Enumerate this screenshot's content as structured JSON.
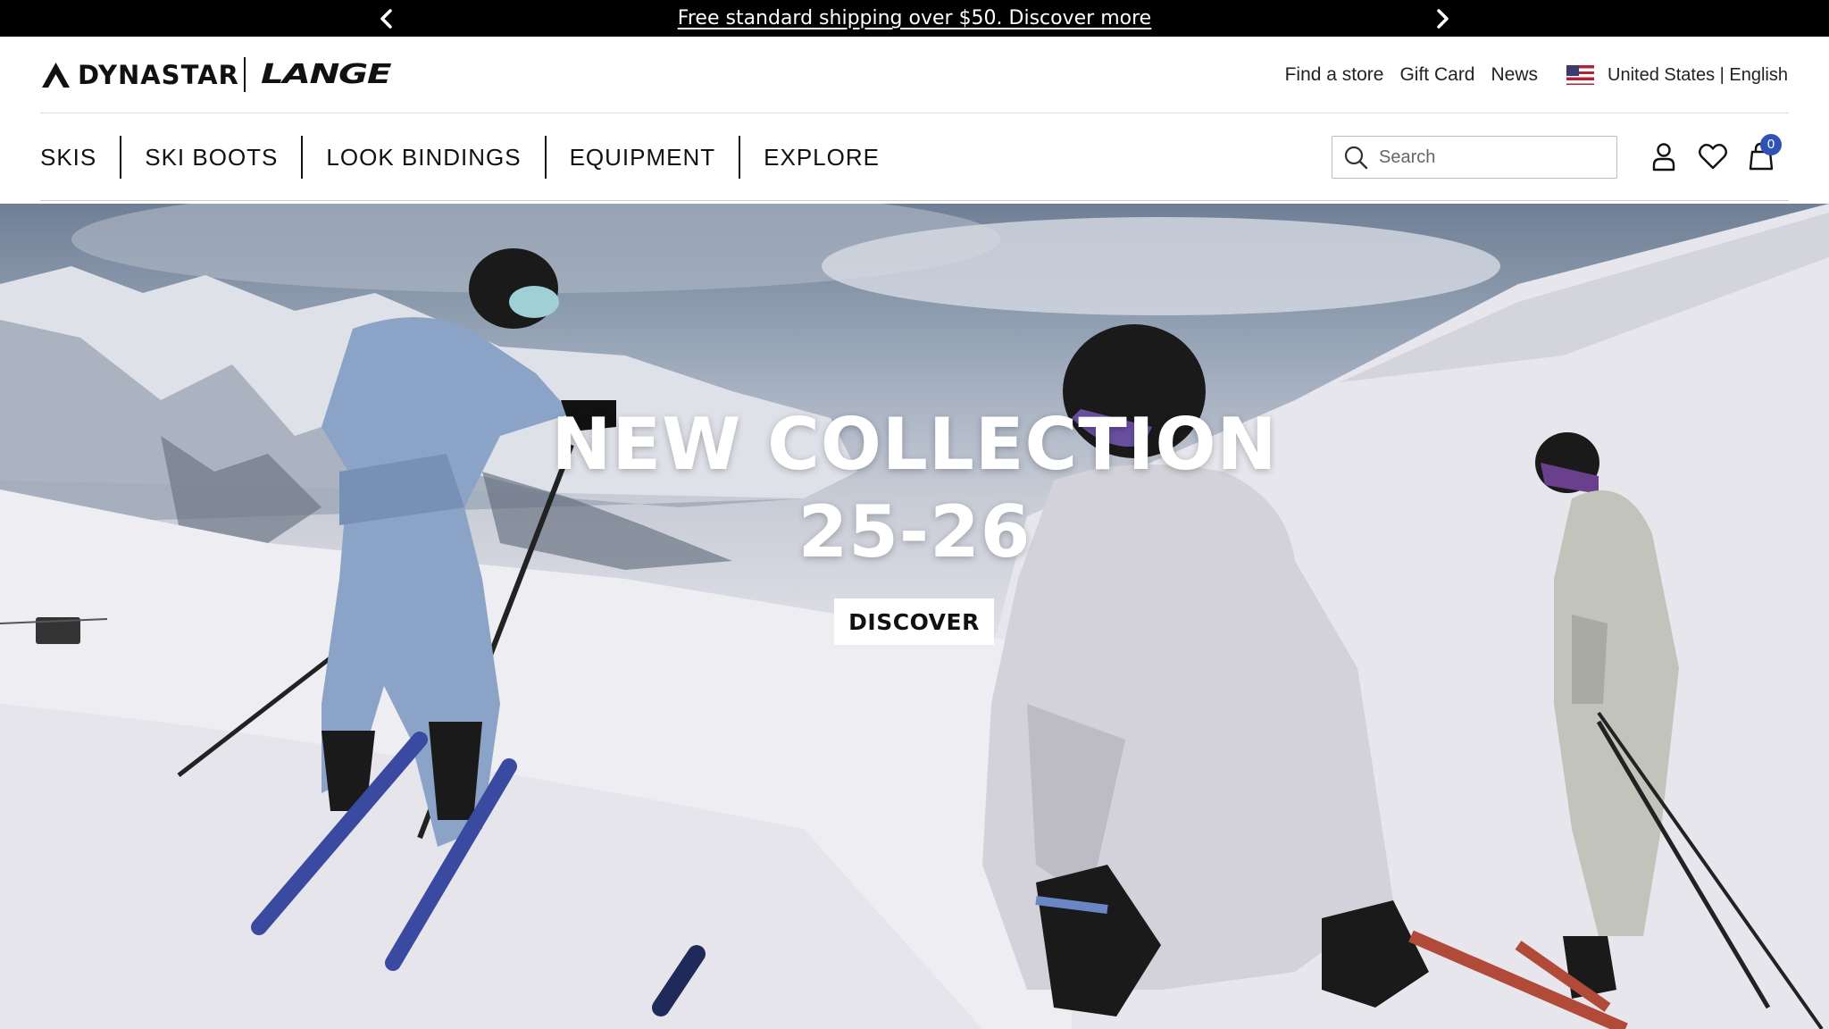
{
  "announcement": {
    "message": "Free standard shipping over $50. Discover more",
    "prev_icon": "chevron-left-icon",
    "next_icon": "chevron-right-icon"
  },
  "brands": {
    "primary": "DYNASTAR",
    "secondary": "LANGE"
  },
  "utility_nav": {
    "links": [
      "Find a store",
      "Gift Card",
      "News"
    ],
    "locale": "United States | English",
    "flag_icon": "us-flag-icon"
  },
  "main_nav": {
    "items": [
      "SKIS",
      "SKI BOOTS",
      "LOOK BINDINGS",
      "EQUIPMENT",
      "EXPLORE"
    ]
  },
  "search": {
    "placeholder": "Search",
    "value": ""
  },
  "account": {
    "account_icon": "user-icon",
    "wishlist_icon": "heart-icon",
    "cart_icon": "shopping-bag-icon",
    "cart_count": "0"
  },
  "hero": {
    "title_line1": "NEW COLLECTION",
    "title_line2": "25-26",
    "cta_label": "DISCOVER"
  },
  "colors": {
    "announcement_bg": "#000000",
    "cart_badge": "#2f52b5",
    "text": "#111111"
  }
}
